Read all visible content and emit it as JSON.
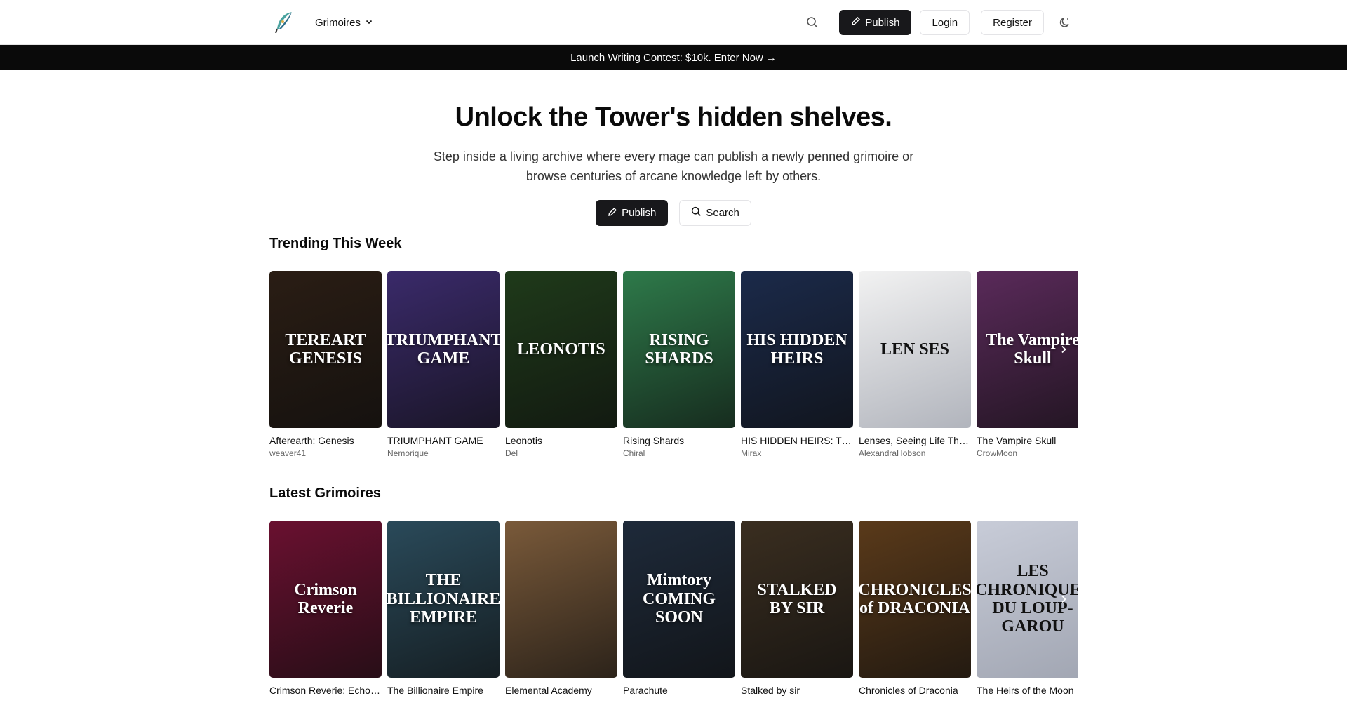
{
  "header": {
    "nav_label": "Grimoires",
    "publish_label": "Publish",
    "login_label": "Login",
    "register_label": "Register"
  },
  "banner": {
    "text": "Launch Writing Contest: $10k.",
    "link": "Enter Now →"
  },
  "hero": {
    "title": "Unlock the Tower's hidden shelves.",
    "subtitle": "Step inside a living archive where every mage can publish a newly penned grimoire or browse centuries of arcane knowledge left by others.",
    "publish_label": "Publish",
    "search_label": "Search"
  },
  "trending": {
    "title": "Trending This Week",
    "books": [
      {
        "title": "Afterearth: Genesis",
        "author": "weaver41",
        "cover_text": "TEREART GENESIS",
        "cover_color": "#2a1d14"
      },
      {
        "title": "TRIUMPHANT GAME",
        "author": "Nemorique",
        "cover_text": "TRIUMPHANT GAME",
        "cover_color": "#3a2a6a"
      },
      {
        "title": "Leonotis",
        "author": "Del",
        "cover_text": "LEONOTIS",
        "cover_color": "#1f3a1a"
      },
      {
        "title": "Rising Shards",
        "author": "Chiral",
        "cover_text": "RISING SHARDS",
        "cover_color": "#2e7a4a"
      },
      {
        "title": "HIS HIDDEN HEIRS: THE MAFIA KING'S CLAIM",
        "author": "Mirax",
        "cover_text": "HIS HIDDEN HEIRS",
        "cover_color": "#1b2a4a"
      },
      {
        "title": "Lenses, Seeing Life Through New Eyes",
        "author": "AlexandraHobson",
        "cover_text": "LEN SES",
        "cover_color": "#f2f2f2"
      },
      {
        "title": "The Vampire Skull",
        "author": "CrowMoon",
        "cover_text": "The Vampire Skull",
        "cover_color": "#5a2a5a"
      }
    ]
  },
  "latest": {
    "title": "Latest Grimoires",
    "books": [
      {
        "title": "Crimson Reverie: Echoes of Seraphine",
        "cover_text": "Crimson Reverie",
        "cover_color": "#6a1030"
      },
      {
        "title": "The Billionaire Empire",
        "cover_text": "THE BILLIONAIRE EMPIRE",
        "cover_color": "#2a4a5a"
      },
      {
        "title": "Elemental Academy",
        "cover_text": "",
        "cover_color": "#7a5a3a"
      },
      {
        "title": "Parachute",
        "cover_text": "Mimtory COMING SOON",
        "cover_color": "#1e2a3a"
      },
      {
        "title": "Stalked by sir",
        "cover_text": "STALKED BY SIR",
        "cover_color": "#3a2e20"
      },
      {
        "title": "Chronicles of Draconia",
        "cover_text": "CHRONICLES of DRACONIA",
        "cover_color": "#5a3a1a"
      },
      {
        "title": "The Heirs of the Moon",
        "cover_text": "LES CHRONIQUES DU LOUP-GAROU",
        "cover_color": "#c8ccd8"
      }
    ]
  }
}
